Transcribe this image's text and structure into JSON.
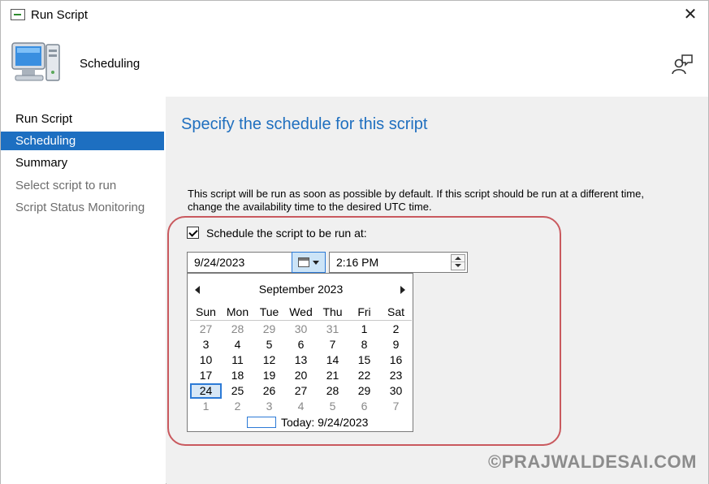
{
  "window": {
    "title": "Run Script"
  },
  "header": {
    "title": "Scheduling"
  },
  "nav": {
    "items": [
      {
        "label": "Run Script",
        "state": "normal"
      },
      {
        "label": "Scheduling",
        "state": "active"
      },
      {
        "label": "Summary",
        "state": "normal"
      },
      {
        "label": "Select script to run",
        "state": "dim"
      },
      {
        "label": "Script Status Monitoring",
        "state": "dim"
      }
    ]
  },
  "main": {
    "heading": "Specify the schedule for this script",
    "description": "This script will be run as soon as possible by default. If this script should be run at a different time, change the availability time to the desired UTC time.",
    "schedule_checkbox_label": "Schedule the script to be run at:",
    "schedule_checked": true,
    "date_value": "9/24/2023",
    "time_value": "2:16 PM"
  },
  "calendar": {
    "month_label": "September 2023",
    "weekdays": [
      "Sun",
      "Mon",
      "Tue",
      "Wed",
      "Thu",
      "Fri",
      "Sat"
    ],
    "weeks": [
      [
        "27",
        "28",
        "29",
        "30",
        "31",
        "1",
        "2"
      ],
      [
        "3",
        "4",
        "5",
        "6",
        "7",
        "8",
        "9"
      ],
      [
        "10",
        "11",
        "12",
        "13",
        "14",
        "15",
        "16"
      ],
      [
        "17",
        "18",
        "19",
        "20",
        "21",
        "22",
        "23"
      ],
      [
        "24",
        "25",
        "26",
        "27",
        "28",
        "29",
        "30"
      ],
      [
        "1",
        "2",
        "3",
        "4",
        "5",
        "6",
        "7"
      ]
    ],
    "other_month": [
      [
        true,
        true,
        true,
        true,
        true,
        false,
        false
      ],
      [
        false,
        false,
        false,
        false,
        false,
        false,
        false
      ],
      [
        false,
        false,
        false,
        false,
        false,
        false,
        false
      ],
      [
        false,
        false,
        false,
        false,
        false,
        false,
        false
      ],
      [
        false,
        false,
        false,
        false,
        false,
        false,
        false
      ],
      [
        true,
        true,
        true,
        true,
        true,
        true,
        true
      ]
    ],
    "selected_day": "24",
    "today_label": "Today: 9/24/2023"
  },
  "watermark": "©PRAJWALDESAI.COM",
  "colors": {
    "accent": "#1d6fc1",
    "heading": "#1f6fbf",
    "highlight_border": "#c9595e"
  },
  "icons": {
    "window": "script-window-icon",
    "close": "close-icon",
    "header": "computer-icon",
    "help": "help-person-icon",
    "calendar_button": "calendar-icon"
  }
}
